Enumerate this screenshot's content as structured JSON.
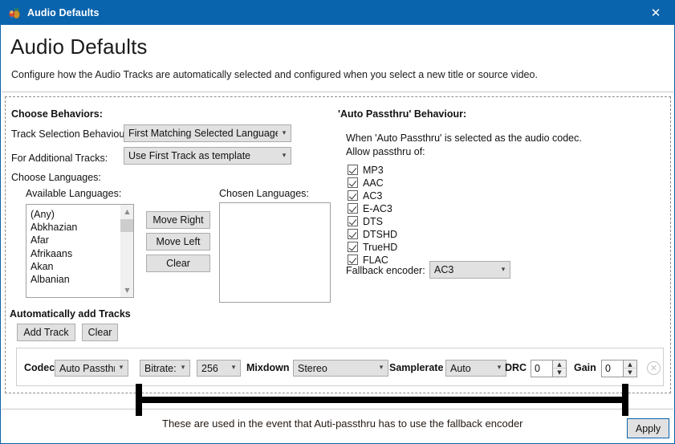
{
  "window": {
    "title": "Audio Defaults",
    "icon": "handbrake-pineapple-icon",
    "close_label": "✕",
    "accent_color": "#0a63ad"
  },
  "header": {
    "title": "Audio Defaults",
    "subtitle": "Configure how the Audio Tracks are automatically selected and configured when you select a new title or source video."
  },
  "behaviors": {
    "group_label": "Choose Behaviors:",
    "track_selection_label": "Track Selection Behaviour:",
    "track_selection_value": "First Matching Selected Language",
    "additional_tracks_label": "For Additional Tracks:",
    "additional_tracks_value": "Use First Track as template",
    "choose_languages_label": "Choose Languages:",
    "available_label": "Available Languages:",
    "chosen_label": "Chosen Languages:",
    "available_items": [
      "(Any)",
      "Abkhazian",
      "Afar",
      "Afrikaans",
      "Akan",
      "Albanian"
    ],
    "chosen_items": [],
    "move_right_label": "Move Right",
    "move_left_label": "Move Left",
    "clear_label": "Clear"
  },
  "passthru": {
    "group_label": "'Auto Passthru' Behaviour:",
    "description_line1": "When 'Auto Passthru' is selected as the audio codec.",
    "description_line2": "Allow passthru of:",
    "codecs": [
      {
        "label": "MP3",
        "checked": true
      },
      {
        "label": "AAC",
        "checked": true
      },
      {
        "label": "AC3",
        "checked": true
      },
      {
        "label": "E-AC3",
        "checked": true
      },
      {
        "label": "DTS",
        "checked": true
      },
      {
        "label": "DTSHD",
        "checked": true
      },
      {
        "label": "TrueHD",
        "checked": true
      },
      {
        "label": "FLAC",
        "checked": true
      }
    ],
    "fallback_label": "Fallback encoder:",
    "fallback_value": "AC3"
  },
  "auto_tracks": {
    "group_label": "Automatically add Tracks",
    "add_track_label": "Add Track",
    "clear_label": "Clear",
    "row": {
      "codec_label": "Codec",
      "codec_value": "Auto Passthru",
      "bitrate_label_value": "Bitrate:",
      "bitrate_value": "256",
      "mixdown_label": "Mixdown",
      "mixdown_value": "Stereo",
      "samplerate_label": "Samplerate",
      "samplerate_value": "Auto",
      "drc_label": "DRC",
      "drc_value": "0",
      "gain_label": "Gain",
      "gain_value": "0",
      "remove_icon": "remove-circle-icon",
      "remove_glyph": "✕"
    }
  },
  "footer": {
    "apply_label": "Apply"
  },
  "annotation": {
    "text": "These are used in the event that Auti-passthru has to use the fallback encoder"
  }
}
